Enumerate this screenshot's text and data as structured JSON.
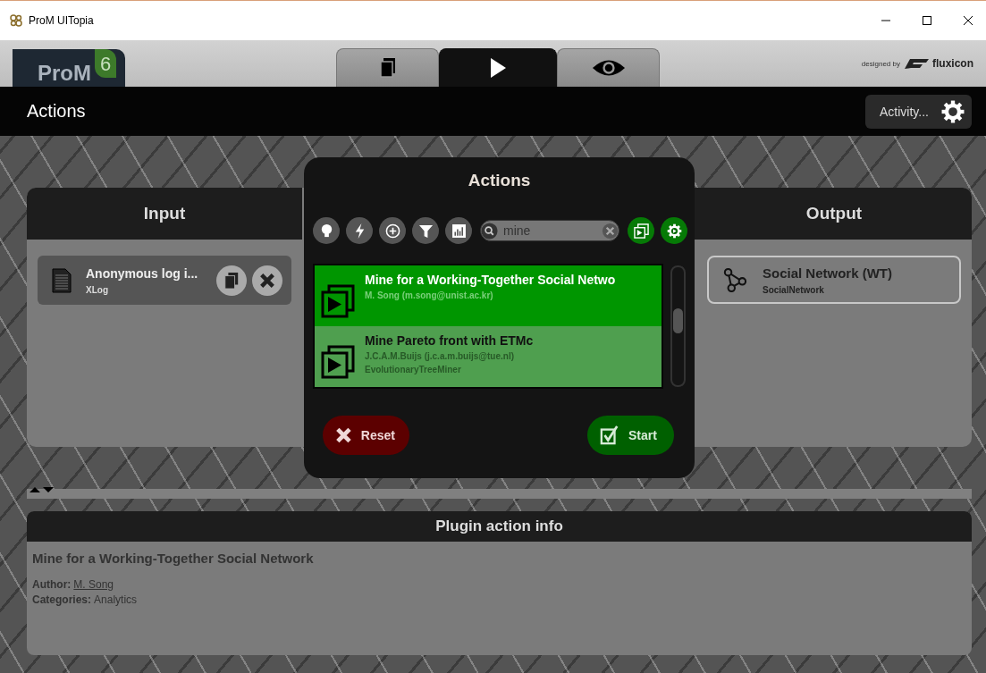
{
  "window": {
    "title": "ProM UITopia"
  },
  "header": {
    "logo": "ProM",
    "logo_version": "6",
    "credit": "designed by",
    "credit_brand": "fluxicon"
  },
  "tabs": [
    {
      "kind": "workspace",
      "selected": false
    },
    {
      "kind": "action",
      "selected": true
    },
    {
      "kind": "view",
      "selected": false
    }
  ],
  "view_title": "Actions",
  "activity_button": "Activity...",
  "input": {
    "title": "Input",
    "items": [
      {
        "name": "Anonymous log i...",
        "type": "XLog"
      }
    ]
  },
  "output": {
    "title": "Output",
    "items": [
      {
        "name": "Social Network (WT)",
        "type": "SocialNetwork"
      }
    ]
  },
  "actions_dialog": {
    "title": "Actions",
    "filters": [
      {
        "kind": "bulb",
        "on": false
      },
      {
        "kind": "bolt",
        "on": false
      },
      {
        "kind": "plus",
        "on": false
      },
      {
        "kind": "funnel",
        "on": false
      },
      {
        "kind": "chart",
        "on": false
      }
    ],
    "search": {
      "value": "mine"
    },
    "toggles": [
      {
        "kind": "plugin",
        "on": true
      },
      {
        "kind": "gear",
        "on": true
      }
    ],
    "items": [
      {
        "title": "Mine for a Working-Together Social Netwo",
        "author": "M. Song (m.song@unist.ac.kr)",
        "selected": true
      },
      {
        "title": "Mine Pareto front with ETMc",
        "author": "J.C.A.M.Buijs (j.c.a.m.buijs@tue.nl)",
        "package": "EvolutionaryTreeMiner",
        "selected": false
      }
    ],
    "reset": "Reset",
    "start": "Start"
  },
  "plugin_info": {
    "title": "Plugin action info",
    "name": "Mine for a Working-Together Social Network",
    "fields": [
      {
        "label": "Author:",
        "value": "M. Song",
        "kind": "link"
      },
      {
        "label": "Categories:",
        "value": "Analytics",
        "kind": "text"
      }
    ]
  }
}
